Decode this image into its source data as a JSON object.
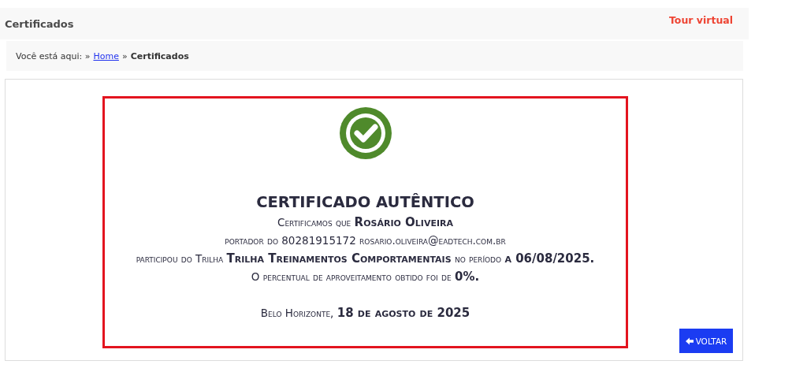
{
  "header": {
    "title": "Certificados",
    "tour_link": "Tour virtual"
  },
  "breadcrumb": {
    "prefix": "Você está aqui: »",
    "items": [
      {
        "label": "Home",
        "kind": "link"
      },
      {
        "label": "»",
        "kind": "separator"
      },
      {
        "label": "Certificados",
        "kind": "current"
      }
    ]
  },
  "certificate": {
    "title": "CERTIFICADO AUTÊNTICO",
    "lines": [
      "Certificamos que **Rosário Oliveira**",
      "portador do 80281915172 rosario.oliveira@eadtech.com.br",
      "participou do Trilha **Trilha Treinamentos Comportamentais** no período **a 06/08/2025.**",
      "O percentual de aproveitamento obtido foi de **0%.**"
    ],
    "place_date": "Belo Horizonte, **18 de agosto de 2025**"
  },
  "back_button": {
    "label": "VOLTAR"
  }
}
